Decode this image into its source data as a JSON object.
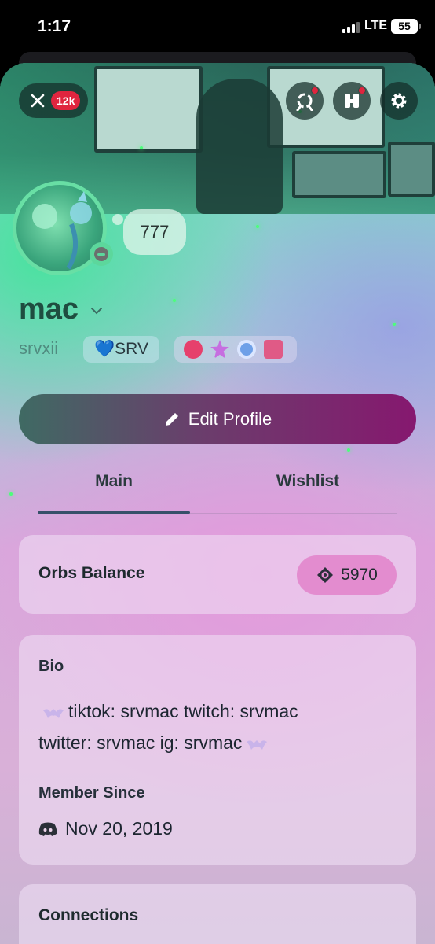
{
  "status_bar": {
    "time": "1:17",
    "network": "LTE",
    "battery": "55"
  },
  "header": {
    "notification_count": "12k"
  },
  "profile": {
    "custom_status": "777",
    "display_name": "mac",
    "username": "srvxii",
    "server_tag": "💙SRV"
  },
  "actions": {
    "edit_profile": "Edit Profile"
  },
  "tabs": [
    {
      "label": "Main"
    },
    {
      "label": "Wishlist"
    }
  ],
  "orbs": {
    "label": "Orbs Balance",
    "value": "5970"
  },
  "bio": {
    "heading": "Bio",
    "line1": "tiktok: srvmac twitch: srvmac",
    "line2": "twitter: srvmac ig: srvmac"
  },
  "member_since": {
    "heading": "Member Since",
    "date": "Nov 20, 2019"
  },
  "connections": {
    "heading": "Connections"
  },
  "colors": {
    "accent": "#86186f",
    "orbs_pill": "#e38ccf",
    "badge_red": "#e0253f",
    "name_green": "#1f4d40"
  },
  "icons": [
    "close-icon",
    "server-boost-icon",
    "shop-icon",
    "gear-icon",
    "pencil-icon",
    "orb-icon",
    "discord-icon",
    "chevron-down-icon"
  ]
}
